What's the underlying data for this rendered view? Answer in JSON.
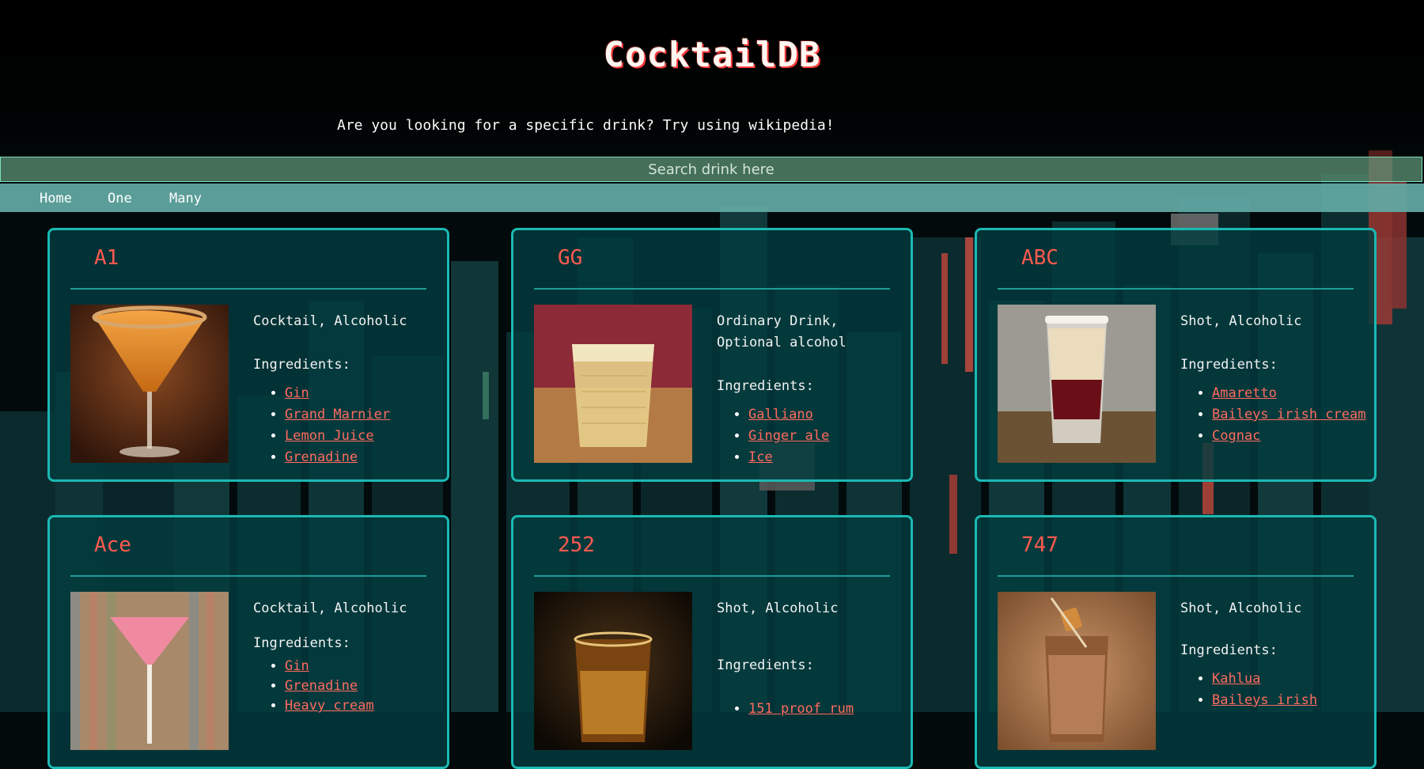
{
  "app": {
    "title": "CocktailDB",
    "subtitle": "Are you looking for a specific drink? Try using wikipedia!"
  },
  "search": {
    "placeholder": "Search drink here",
    "value": ""
  },
  "nav": {
    "items": [
      "Home",
      "One",
      "Many"
    ]
  },
  "drinks": [
    {
      "name": "A1",
      "category": "Cocktail, Alcoholic",
      "ingredients_label": "Ingredients:",
      "ingredients": [
        "Gin",
        "Grand Marnier",
        "Lemon Juice",
        "Grenadine"
      ]
    },
    {
      "name": "GG",
      "category": "Ordinary Drink, Optional alcohol",
      "ingredients_label": "Ingredients:",
      "ingredients": [
        "Galliano",
        "Ginger ale",
        "Ice"
      ]
    },
    {
      "name": "ABC",
      "category": "Shot, Alcoholic",
      "ingredients_label": "Ingredients:",
      "ingredients": [
        "Amaretto",
        "Baileys irish cream",
        "Cognac"
      ]
    },
    {
      "name": "Ace",
      "category": "Cocktail, Alcoholic",
      "ingredients_label": "Ingredients:",
      "ingredients": [
        "Gin",
        "Grenadine",
        "Heavy cream"
      ]
    },
    {
      "name": "252",
      "category": "Shot, Alcoholic",
      "ingredients_label": "Ingredients:",
      "ingredients": [
        "151 proof rum"
      ]
    },
    {
      "name": "747",
      "category": "Shot, Alcoholic",
      "ingredients_label": "Ingredients:",
      "ingredients": [
        "Kahlua",
        "Baileys irish"
      ]
    }
  ],
  "colors": {
    "accent_red": "#ff5a4f",
    "card_border": "#1bb9b3",
    "nav_bar": "#62aaa5",
    "search_bar": "#588c6e"
  }
}
